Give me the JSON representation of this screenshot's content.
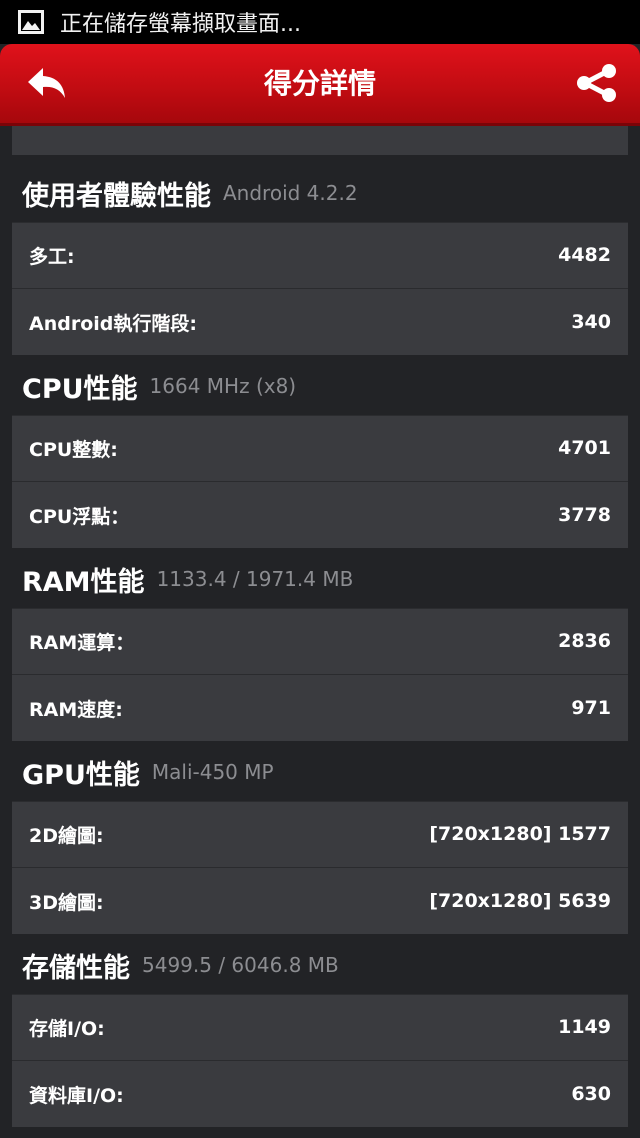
{
  "status_bar": {
    "notification_text": "正在儲存螢幕擷取畫面..."
  },
  "app_bar": {
    "title": "得分詳情"
  },
  "sections": [
    {
      "title": "使用者體驗性能",
      "subtitle": "Android 4.2.2",
      "rows": [
        {
          "label": "多工:",
          "value": "4482"
        },
        {
          "label": "Android執行階段:",
          "value": "340"
        }
      ]
    },
    {
      "title": "CPU性能",
      "subtitle": "1664 MHz (x8)",
      "rows": [
        {
          "label": "CPU整數:",
          "value": "4701"
        },
        {
          "label": "CPU浮點：",
          "value": "3778"
        }
      ]
    },
    {
      "title": "RAM性能",
      "subtitle": "1133.4 / 1971.4 MB",
      "rows": [
        {
          "label": "RAM運算：",
          "value": "2836"
        },
        {
          "label": "RAM速度:",
          "value": "971"
        }
      ]
    },
    {
      "title": "GPU性能",
      "subtitle": "Mali-450 MP",
      "rows": [
        {
          "label": "2D繪圖:",
          "value": "[720x1280] 1577"
        },
        {
          "label": "3D繪圖:",
          "value": "[720x1280] 5639"
        }
      ]
    },
    {
      "title": "存儲性能",
      "subtitle": "5499.5 / 6046.8 MB",
      "rows": [
        {
          "label": "存儲I/O:",
          "value": "1149"
        },
        {
          "label": "資料庫I/O:",
          "value": "630"
        }
      ]
    }
  ],
  "icons": {
    "status": "image-icon",
    "back": "back-arrow-icon",
    "share": "share-icon"
  },
  "colors": {
    "app_bar": "#c20c12",
    "background": "#222326",
    "card": "#3a3b3f",
    "subtitle": "#8c8d91"
  }
}
